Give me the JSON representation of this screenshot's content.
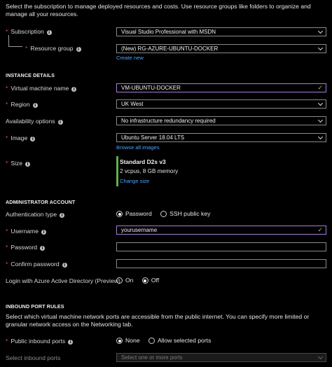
{
  "intro_text": "Select the subscription to manage deployed resources and costs. Use resource groups like folders to organize and manage all your resources.",
  "project": {
    "subscription": {
      "label": "Subscription",
      "value": "Visual Studio Professional with MSDN"
    },
    "resource_group": {
      "label": "Resource group",
      "value": "(New) RG-AZURE-UBUNTU-DOCKER",
      "link": "Create new"
    }
  },
  "instance": {
    "header": "INSTANCE DETAILS",
    "vm_name": {
      "label": "Virtual machine name",
      "value": "VM-UBUNTU-DOCKER"
    },
    "region": {
      "label": "Region",
      "value": "UK West"
    },
    "availability": {
      "label": "Availability options",
      "value": "No infrastructure redundancy required"
    },
    "image": {
      "label": "Image",
      "value": "Ubuntu Server 18.04 LTS",
      "link": "Browse all images"
    },
    "size": {
      "label": "Size",
      "name": "Standard D2s v3",
      "detail": "2 vcpus, 8 GB memory",
      "link": "Change size"
    }
  },
  "admin": {
    "header": "ADMINISTRATOR ACCOUNT",
    "auth_type": {
      "label": "Authentication type",
      "options": [
        "Password",
        "SSH public key"
      ],
      "selected": "Password"
    },
    "username": {
      "label": "Username",
      "value": "yourusername"
    },
    "password": {
      "label": "Password",
      "value": ""
    },
    "confirm_password": {
      "label": "Confirm password",
      "value": ""
    },
    "aad_login": {
      "label": "Login with Azure Active Directory (Preview)",
      "options": [
        "On",
        "Off"
      ],
      "selected": "Off"
    }
  },
  "inbound": {
    "header": "INBOUND PORT RULES",
    "description": "Select which virtual machine network ports are accessible from the public internet. You can specify more limited or granular network access on the Networking tab.",
    "public_ports": {
      "label": "Public inbound ports",
      "options": [
        "None",
        "Allow selected ports"
      ],
      "selected": "None"
    },
    "select_ports": {
      "label": "Select inbound ports",
      "placeholder": "Select one or more ports"
    }
  },
  "colors": {
    "accent_link": "#4aa3ff",
    "focus_border": "#a77fd6",
    "valid_check": "#7fd36b",
    "size_bar": "#5db347",
    "required": "#e04b4b"
  }
}
